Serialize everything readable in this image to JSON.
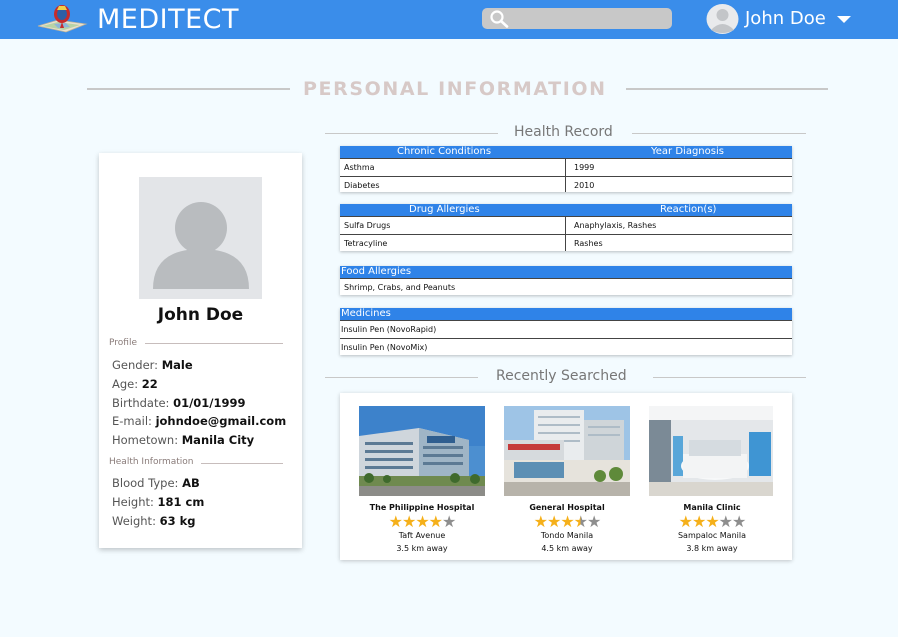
{
  "header": {
    "brand": "MEDITECT",
    "search_placeholder": "",
    "user_name": "John Doe"
  },
  "page_title": "PERSONAL INFORMATION",
  "profile": {
    "name": "John Doe",
    "profile_label": "Profile",
    "fields": [
      {
        "key": "Gender:",
        "value": "Male"
      },
      {
        "key": "Age:",
        "value": "22"
      },
      {
        "key": "Birthdate:",
        "value": "01/01/1999"
      },
      {
        "key": "E-mail:",
        "value": "johndoe@gmail.com"
      },
      {
        "key": "Hometown:",
        "value": "Manila City"
      }
    ],
    "health_label": "Health Information",
    "health_fields": [
      {
        "key": "Blood Type:",
        "value": "AB"
      },
      {
        "key": "Height:",
        "value": "181 cm"
      },
      {
        "key": "Weight:",
        "value": "63 kg"
      }
    ]
  },
  "health_record": {
    "title": "Health Record",
    "chronic": {
      "headers": [
        "Chronic Conditions",
        "Year Diagnosis"
      ],
      "rows": [
        [
          "Asthma",
          "1999"
        ],
        [
          "Diabetes",
          "2010"
        ]
      ]
    },
    "drug_allergies": {
      "headers": [
        "Drug Allergies",
        "Reaction(s)"
      ],
      "rows": [
        [
          "Sulfa Drugs",
          "Anaphylaxis, Rashes"
        ],
        [
          "Tetracyline",
          "Rashes"
        ]
      ]
    },
    "food_allergies": {
      "header": "Food Allergies",
      "rows": [
        "Shrimp, Crabs, and Peanuts"
      ]
    },
    "medicines": {
      "header": "Medicines",
      "rows": [
        "Insulin Pen (NovoRapid)",
        "Insulin Pen (NovoMix)"
      ]
    }
  },
  "recent": {
    "title": "Recently Searched",
    "items": [
      {
        "name": "The Philippine Hospital",
        "rating": 4,
        "location": "Taft Avenue",
        "distance": "3.5 km away",
        "image": "hospital-building-photo"
      },
      {
        "name": "General Hospital",
        "rating": 3.5,
        "location": "Tondo Manila",
        "distance": "4.5 km away",
        "image": "hospital-emergency-entrance-photo"
      },
      {
        "name": "Manila Clinic",
        "rating": 3,
        "location": "Sampaloc Manila",
        "distance": "3.8 km away",
        "image": "clinic-reception-photo"
      }
    ]
  },
  "colors": {
    "header_blue": "#3a8dea",
    "table_header_blue": "#2f83e8",
    "star_gold": "#f5b01a",
    "star_gray": "#8e8e8e",
    "background": "#f3fbff"
  }
}
